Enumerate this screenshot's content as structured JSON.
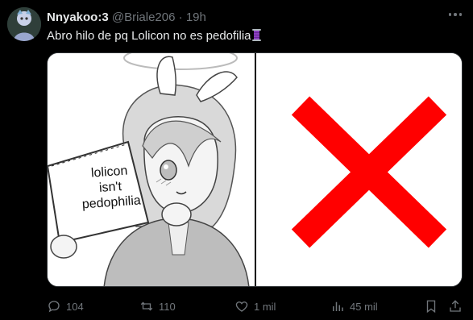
{
  "tweet": {
    "display_name": "Nnyakoo:3",
    "handle": "@Briale206",
    "separator": "·",
    "time": "19h",
    "text": "Abro hilo de pq Lolicon no es pedofilia",
    "text_emoji": "spool-of-thread-emoji"
  },
  "media": {
    "left_panel": {
      "description_icon": "anime-girl-holding-sign-illustration",
      "sign_lines": [
        "lolicon",
        "isn't",
        "pedophilia"
      ]
    },
    "right_panel": {
      "icon": "red-x-mark",
      "color": "#ff0000"
    }
  },
  "actions": {
    "replies": "104",
    "retweets": "110",
    "likes": "1 mil",
    "views": "45 mil"
  },
  "colors": {
    "background": "#000000",
    "text": "#e7e9ea",
    "muted": "#71767b",
    "x_mark": "#ff0000"
  }
}
